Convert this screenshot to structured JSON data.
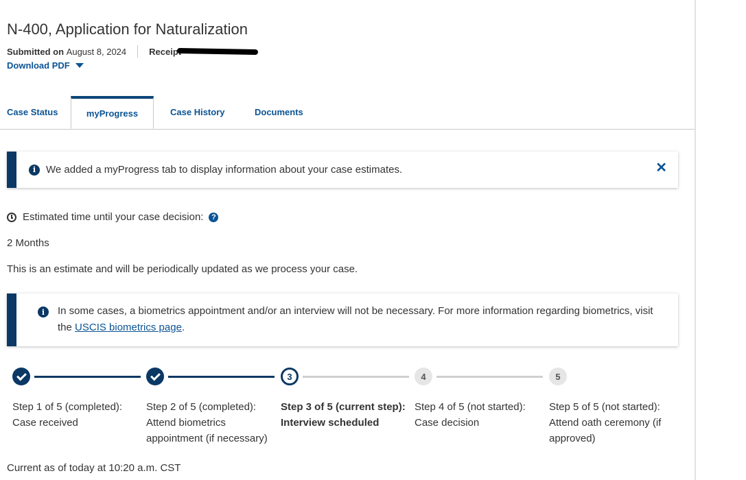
{
  "header": {
    "title": "N-400, Application for Naturalization",
    "submitted_label": "Submitted on",
    "submitted_date": "August 8, 2024",
    "receipt_label": "Receipt",
    "download_label": "Download PDF"
  },
  "tabs": [
    {
      "label": "Case Status",
      "active": false
    },
    {
      "label": "myProgress",
      "active": true
    },
    {
      "label": "Case History",
      "active": false
    },
    {
      "label": "Documents",
      "active": false
    }
  ],
  "notice": {
    "text": "We added a myProgress tab to display information about your case estimates.",
    "close_icon": "close-icon"
  },
  "estimate": {
    "label": "Estimated time until your case decision:",
    "value": "2 Months",
    "note": "This is an estimate and will be periodically updated as we process your case."
  },
  "biometrics_notice": {
    "text_before": "In some cases, a biometrics appointment and/or an interview will not be necessary. For more information regarding biometrics, visit the ",
    "link_text": "USCIS biometrics page",
    "text_after": "."
  },
  "steps": [
    {
      "number": "1",
      "status": "completed",
      "label_line1": "Step 1 of 5 (completed):",
      "label_line2": "Case received"
    },
    {
      "number": "2",
      "status": "completed",
      "label_line1": "Step 2 of 5 (completed):",
      "label_line2": "Attend biometrics appointment (if necessary)"
    },
    {
      "number": "3",
      "status": "current",
      "label_line1": "Step 3 of 5 (current step):",
      "label_line2": "Interview scheduled"
    },
    {
      "number": "4",
      "status": "not_started",
      "label_line1": "Step 4 of 5 (not started):",
      "label_line2": "Case decision"
    },
    {
      "number": "5",
      "status": "not_started",
      "label_line1": "Step 5 of 5 (not started):",
      "label_line2": "Attend oath ceremony (if approved)"
    }
  ],
  "footer": {
    "current_as": "Current as of today at 10:20 a.m. CST"
  },
  "colors": {
    "primary_dark": "#0b3864",
    "link": "#0b5394",
    "incomplete": "#cfcfcf"
  }
}
